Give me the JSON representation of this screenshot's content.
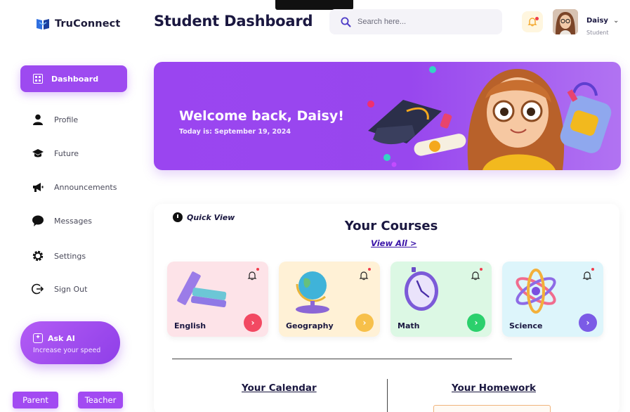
{
  "brand": {
    "name": "TruConnect"
  },
  "sidebar": {
    "active": {
      "label": "Dashboard"
    },
    "items": [
      {
        "label": "Profile"
      },
      {
        "label": "Future"
      },
      {
        "label": "Announcements"
      },
      {
        "label": "Messages"
      },
      {
        "label": "Settings"
      },
      {
        "label": "Sign Out"
      }
    ],
    "ask_ai": {
      "title": "Ask AI",
      "subtitle": "Increase your speed"
    },
    "roles": [
      "Parent",
      "Teacher"
    ]
  },
  "header": {
    "title": "Student Dashboard",
    "search_placeholder": "Search here...",
    "user": {
      "name": "Daisy",
      "role": "Student"
    }
  },
  "banner": {
    "greeting": "Welcome back, Daisy!",
    "date": "Today is: September 19, 2024"
  },
  "quick_view": {
    "label": "Quick View",
    "title": "Your Courses",
    "view_all": "View All >",
    "courses": [
      {
        "name": "English",
        "bg": "#fde3e8",
        "btn": "#f24962"
      },
      {
        "name": "Geography",
        "bg": "#fff1d6",
        "btn": "#f7c04a"
      },
      {
        "name": "Math",
        "bg": "#dcf8e4",
        "btn": "#2bd06c"
      },
      {
        "name": "Science",
        "bg": "#ddf5fb",
        "btn": "#7b5be6"
      }
    ]
  },
  "sections": {
    "calendar": "Your Calendar",
    "homework": "Your Homework"
  },
  "colors": {
    "accent": "#9d4af0",
    "title": "#1a1740"
  }
}
